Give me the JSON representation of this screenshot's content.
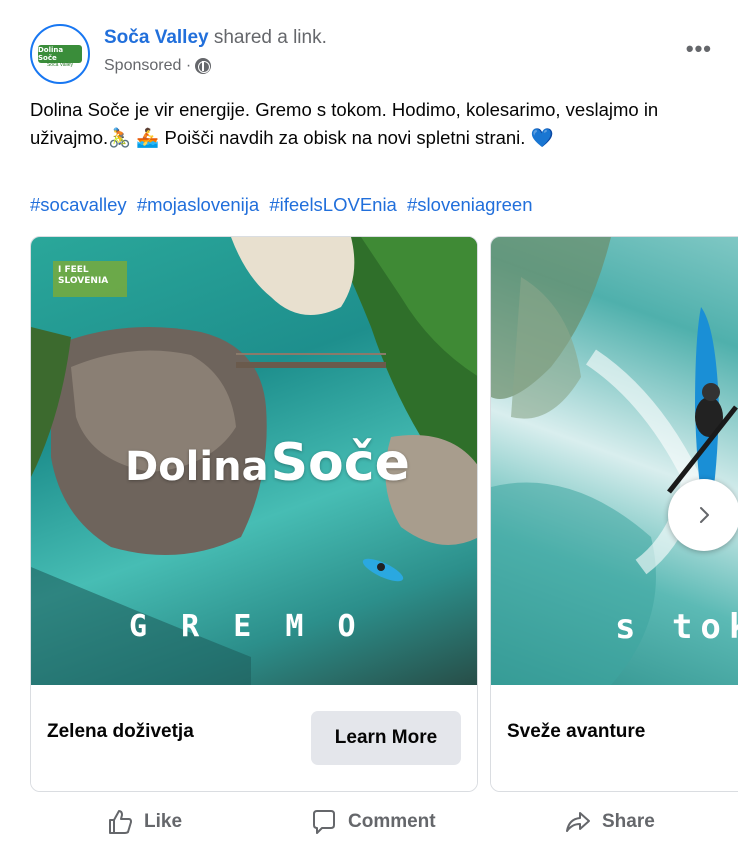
{
  "post": {
    "page_name": "Soča Valley",
    "action": " shared a link.",
    "sponsored": "Sponsored ·",
    "more": "•••",
    "text": "Dolina Soče je vir energije. Gremo s tokom. Hodimo, kolesarimo, veslajmo in uživajmo.🚴 🚣 Poišči navdih za obisk na novi spletni strani. 💙",
    "hashtags": [
      "#socavalley",
      "#mojaslovenija",
      "#ifeelsLOVEnia",
      "#sloveniagreen"
    ]
  },
  "avatar": {
    "logo_text": "Dolina Soče",
    "logo_sub": "Soča Valley"
  },
  "carousel": {
    "cards": [
      {
        "badge_line1": "I FEEL",
        "badge_line2": "SLOVENIA",
        "overlay_title_a": "Dolina",
        "overlay_title_b": "Soče",
        "overlay_word": "G R E M O",
        "title": "Zelena doživetja",
        "cta": "Learn More"
      },
      {
        "overlay_word": "s tok",
        "title": "Sveže avanture"
      }
    ]
  },
  "actions": {
    "like": "Like",
    "comment": "Comment",
    "share": "Share"
  },
  "colors": {
    "link_blue": "#216fdb",
    "secondary_text": "#65676b",
    "button_bg": "#e4e6eb"
  }
}
